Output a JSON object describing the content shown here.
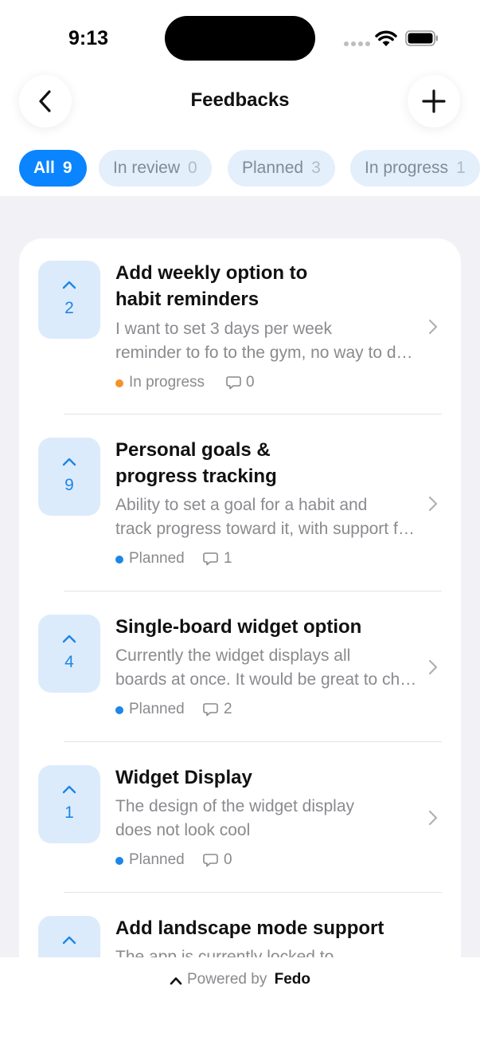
{
  "status_bar": {
    "time": "9:13",
    "icons": [
      "cellular-icon",
      "wifi-icon",
      "battery-icon"
    ]
  },
  "header": {
    "title": "Feedbacks",
    "back_icon": "chevron-left-icon",
    "add_icon": "plus-icon"
  },
  "filters": [
    {
      "label": "All",
      "count": "9",
      "active": true
    },
    {
      "label": "In review",
      "count": "0",
      "active": false
    },
    {
      "label": "Planned",
      "count": "3",
      "active": false
    },
    {
      "label": "In progress",
      "count": "1",
      "active": false
    }
  ],
  "colors": {
    "accent": "#0a84ff",
    "in_progress": "#f5922a",
    "planned": "#1d86e8",
    "background": "#f1f1f6"
  },
  "items": [
    {
      "votes": "2",
      "title_lines": [
        "Add weekly option to",
        "habit reminders"
      ],
      "desc_lines": [
        "I want to set 3 days per week",
        "reminder to fo to the gym, no way to do this now"
      ],
      "status": "In progress",
      "comments": "0"
    },
    {
      "votes": "9",
      "title_lines": [
        "Personal goals &",
        "progress tracking"
      ],
      "desc_lines": [
        "Ability to set a goal for a habit and",
        "track progress toward it, with support for targets"
      ],
      "status": "Planned",
      "comments": "1"
    },
    {
      "votes": "4",
      "title_lines": [
        "Single-board widget option"
      ],
      "desc_lines": [
        "Currently the widget displays all",
        "boards at once. It would be great to choose one"
      ],
      "status": "Planned",
      "comments": "2"
    },
    {
      "votes": "1",
      "title_lines": [
        "Widget Display"
      ],
      "desc_lines": [
        "The design of the widget display",
        "does not look cool"
      ],
      "status": "Planned",
      "comments": "0"
    },
    {
      "title_lines": [
        "Add landscape mode support"
      ],
      "desc_lines": [
        "The app is currently locked to"
      ]
    }
  ],
  "footer": {
    "prefix": "Powered by",
    "brand": "Fedo"
  }
}
